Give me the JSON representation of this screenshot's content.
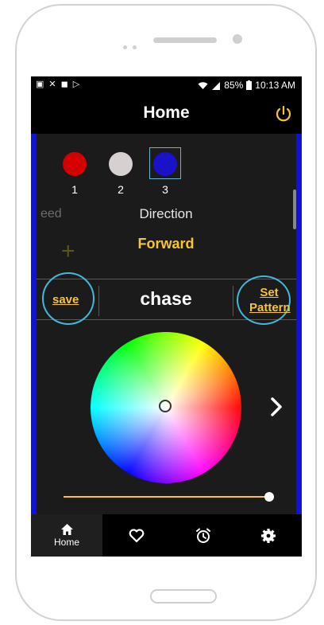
{
  "status_bar": {
    "battery": "85%",
    "time": "10:13 AM"
  },
  "app_bar": {
    "title": "Home"
  },
  "swatches": [
    {
      "label": "1",
      "color": "#d40000"
    },
    {
      "label": "2",
      "color": "#d6d0d0"
    },
    {
      "label": "3",
      "color": "#1a12c8"
    }
  ],
  "direction": {
    "label_partial": "eed",
    "label": "Direction",
    "value": "Forward"
  },
  "pattern_row": {
    "save_label": "save",
    "pattern_name": "chase",
    "set_pattern_label_1": "Set",
    "set_pattern_label_2": "Pattern"
  },
  "brightness": {
    "value_fraction": 1.0
  },
  "nav": {
    "home_label": "Home"
  },
  "colors": {
    "accent": "#f4c53a",
    "side_bar": "#1111dd",
    "highlight": "#43b8d9"
  }
}
